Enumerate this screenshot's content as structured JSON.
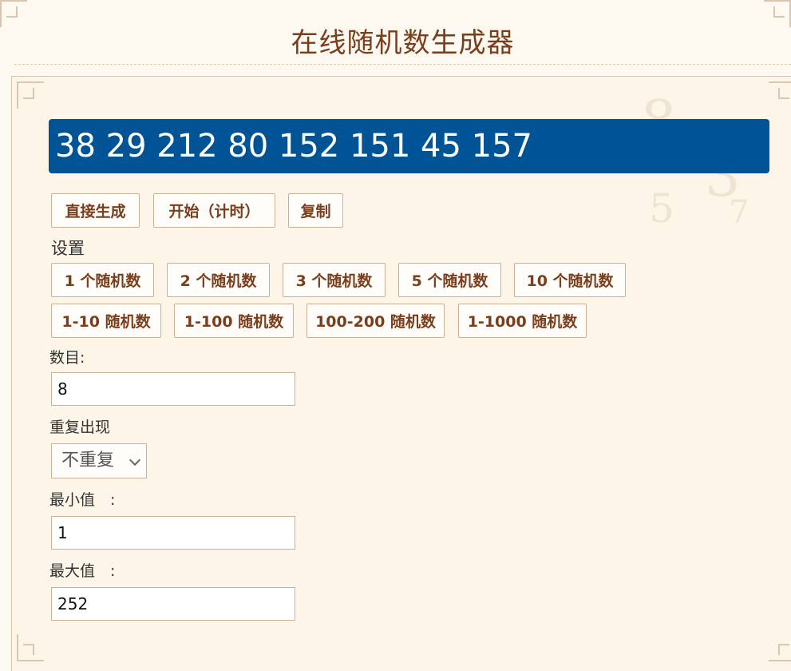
{
  "header": {
    "title": "在线随机数生成器"
  },
  "result": {
    "numbers": "38 29 212 80 152 151 45 157"
  },
  "actions": {
    "generate": "直接生成",
    "start_timed": "开始（计时）",
    "copy": "复制"
  },
  "settings": {
    "label": "设置",
    "count_presets": [
      "1 个随机数",
      "2 个随机数",
      "3 个随机数",
      "5 个随机数",
      "10 个随机数"
    ],
    "range_presets": [
      "1-10 随机数",
      "1-100 随机数",
      "100-200 随机数",
      "1-1000 随机数"
    ]
  },
  "form": {
    "count_label": "数目:",
    "count_value": "8",
    "repeat_label": "重复出现",
    "repeat_selected": "不重复",
    "min_label": "最小值　:",
    "min_value": "1",
    "max_label": "最大值　:",
    "max_value": "252"
  },
  "colors": {
    "accent": "#005496",
    "button_text": "#7a3e1c",
    "background": "#fdf5e8"
  },
  "icons": {
    "select_arrow": "chevron-down-icon"
  }
}
